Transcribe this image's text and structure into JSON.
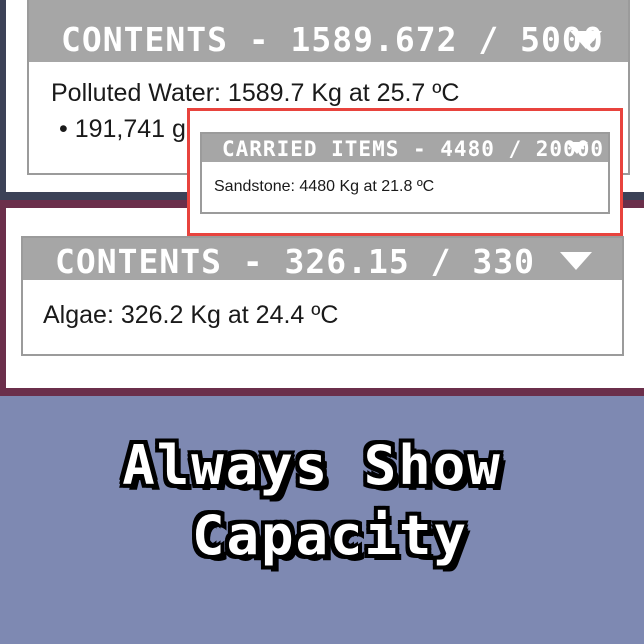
{
  "top_panel": {
    "header_title": "CONTENTS - 1589.672 / 5000",
    "line1": "Polluted Water: 1589.7 Kg at 25.7 ºC",
    "line2": "• 191,741 g"
  },
  "carried_items_popup": {
    "header_title": "CARRIED ITEMS - 4480 / 20000",
    "line1": "Sandstone: 4480 Kg at 21.8 ºC"
  },
  "middle_panel": {
    "header_title": "CONTENTS - 326.15 / 330",
    "line1": "Algae: 326.2 Kg at 24.4 ºC"
  },
  "caption": {
    "line1": "Always Show",
    "line2": "Capacity"
  },
  "colors": {
    "top_band": "#3c4257",
    "middle_band": "#6b2f4b",
    "bottom_background": "#7e89b2",
    "header_bar": "#a6a6a6",
    "highlight_border": "#e8433d"
  },
  "icons": [
    "collapse-chevron-icon"
  ]
}
